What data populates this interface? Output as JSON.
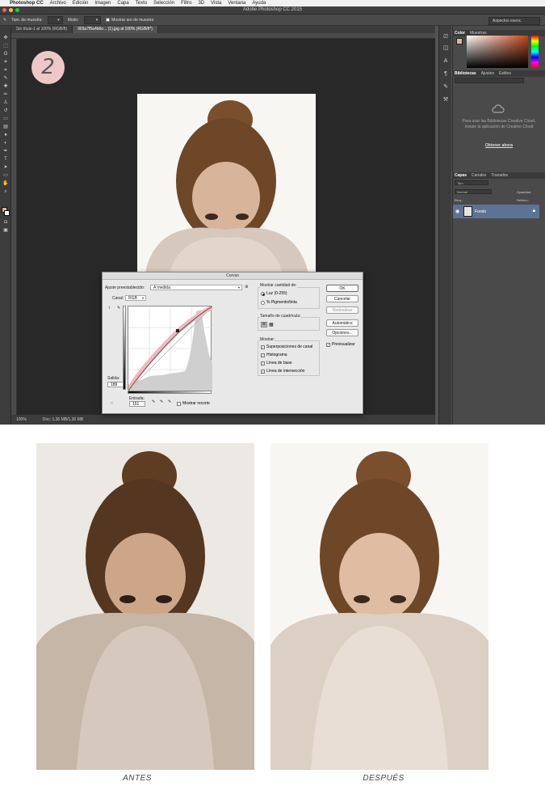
{
  "menubar": {
    "app": "Photoshop CC",
    "items": [
      "Archivo",
      "Edición",
      "Imagen",
      "Capa",
      "Texto",
      "Selección",
      "Filtro",
      "3D",
      "Vista",
      "Ventana",
      "Ayuda"
    ]
  },
  "window": {
    "title": "Adobe Photoshop CC 2015"
  },
  "options_bar": {
    "size_label": "Tam. de muestra:",
    "mode_label": "Modo:",
    "show_ring": "Mostrar aro de muestra",
    "workspace": "Aspectos esenc."
  },
  "document_tabs": [
    {
      "label": "Sin título-1 al 100% (RGB/8)"
    },
    {
      "label": "903a7f5a4b6e... (1).jpg al 100% (RGB/8*)"
    }
  ],
  "step_number": "2",
  "status": {
    "zoom": "100%",
    "doc": "Doc: 1,36 MB/1,36 MB"
  },
  "panels": {
    "color_tabs": [
      "Color",
      "Muestras"
    ],
    "library_tabs": [
      "Bibliotecas",
      "Ajustes",
      "Estilos"
    ],
    "library_message": "Para usar las Bibliotecas Creative Cloud, instale la aplicación de Creative Cloud",
    "library_link": "Obtener ahora",
    "layers_tabs": [
      "Capas",
      "Canales",
      "Trazados"
    ],
    "layers_kind": "Tipo",
    "blend_mode": "Normal",
    "opacity_label": "Opacidad:",
    "lock_label": "Bloq.:",
    "fill_label": "Relleno:",
    "layer_name": "Fondo"
  },
  "curves_dialog": {
    "title": "Curvas",
    "preset_label": "Ajuste preestablecido:",
    "preset_value": "A medida",
    "channel_label": "Canal:",
    "channel_value": "RGB",
    "output_label": "Salida:",
    "output_value": "189",
    "input_label": "Entrada:",
    "input_value": "151",
    "show_clipping": "Mostrar recorte",
    "show_amount_title": "Mostrar cantidad de:",
    "light_option": "Luz (0-255)",
    "pigment_option": "% Pigmento/tinta",
    "grid_size_title": "Tamaño de cuadrícula:",
    "show_title": "Mostrar:",
    "show_options": [
      "Superposiciones de canal",
      "Histograma",
      "Línea de base",
      "Línea de intersección"
    ],
    "buttons": {
      "ok": "OK",
      "cancel": "Cancelar",
      "smooth": "Redondear",
      "auto": "Automático",
      "options": "Opciones..."
    },
    "preview": "Previsualizar"
  },
  "captions": {
    "before": "ANTES",
    "after": "DESPUÉS"
  }
}
